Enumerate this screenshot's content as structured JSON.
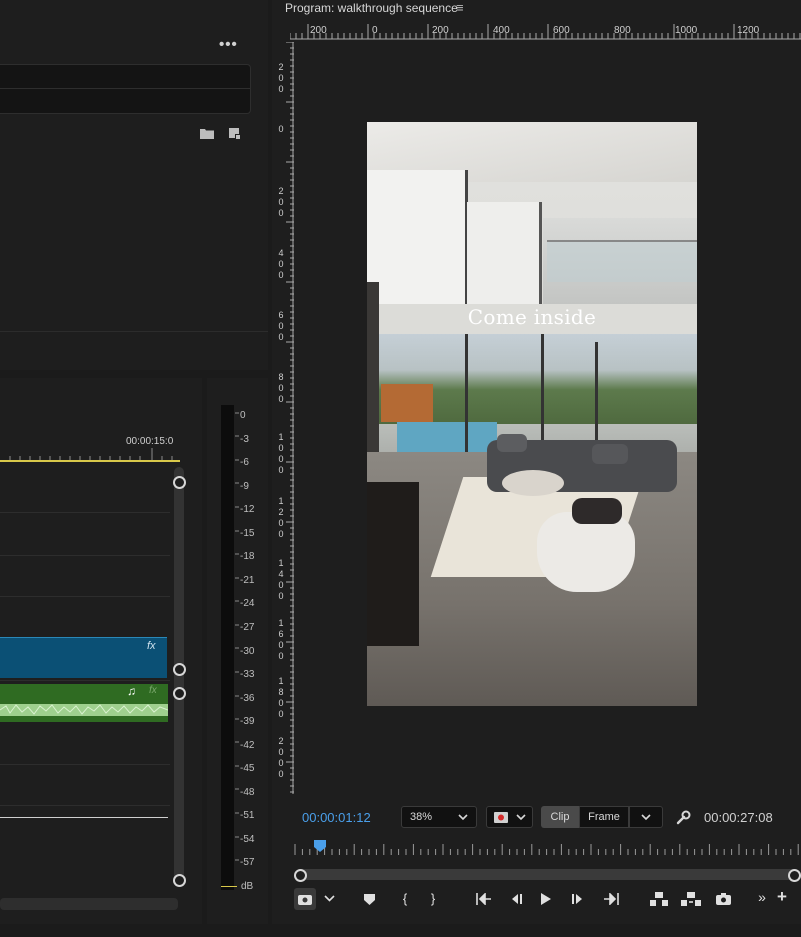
{
  "project_panel": {
    "menu_label": "•••",
    "folder_icon": "folder-icon",
    "new_item_icon": "new-item-icon"
  },
  "timeline": {
    "timecode_marker": "00:00:15:0",
    "fx_label": "fx",
    "audio_fx_label": "fx",
    "music_note": "♫"
  },
  "audio_meter": {
    "labels": [
      "0",
      "-3",
      "-6",
      "-9",
      "-12",
      "-15",
      "-18",
      "-21",
      "-24",
      "-27",
      "-30",
      "-33",
      "-36",
      "-39",
      "-42",
      "-45",
      "-48",
      "-51",
      "-54",
      "-57",
      "dB"
    ]
  },
  "program_monitor": {
    "title": "Program: walkthrough sequence",
    "menu_icon": "≡",
    "ruler_h": [
      "200",
      "0",
      "200",
      "400",
      "600",
      "800",
      "1000",
      "1200"
    ],
    "ruler_v": [
      [
        "2",
        "0",
        "0"
      ],
      [
        "0"
      ],
      [
        "2",
        "0",
        "0"
      ],
      [
        "4",
        "0",
        "0"
      ],
      [
        "6",
        "0",
        "0"
      ],
      [
        "8",
        "0",
        "0"
      ],
      [
        "1",
        "0",
        "0",
        "0"
      ],
      [
        "1",
        "2",
        "0",
        "0"
      ],
      [
        "1",
        "4",
        "0",
        "0"
      ],
      [
        "1",
        "6",
        "0",
        "0"
      ],
      [
        "1",
        "8",
        "0",
        "0"
      ],
      [
        "2",
        "0",
        "0",
        "0"
      ]
    ],
    "overlay_text": "Come inside",
    "current_time": "00:00:01:12",
    "zoom": "38%",
    "clip_label": "Clip",
    "frame_label": "Frame",
    "duration": "00:00:27:08",
    "accent_color": "#4a9fea",
    "controls": [
      "camera-icon",
      "chevron-down-icon",
      "marker-icon",
      "mark-in-icon",
      "mark-out-icon",
      "go-to-in-icon",
      "step-back-icon",
      "play-icon",
      "step-forward-icon",
      "go-to-out-icon",
      "lift-icon",
      "extract-icon",
      "export-frame-icon",
      "more-icon",
      "add-icon"
    ]
  }
}
